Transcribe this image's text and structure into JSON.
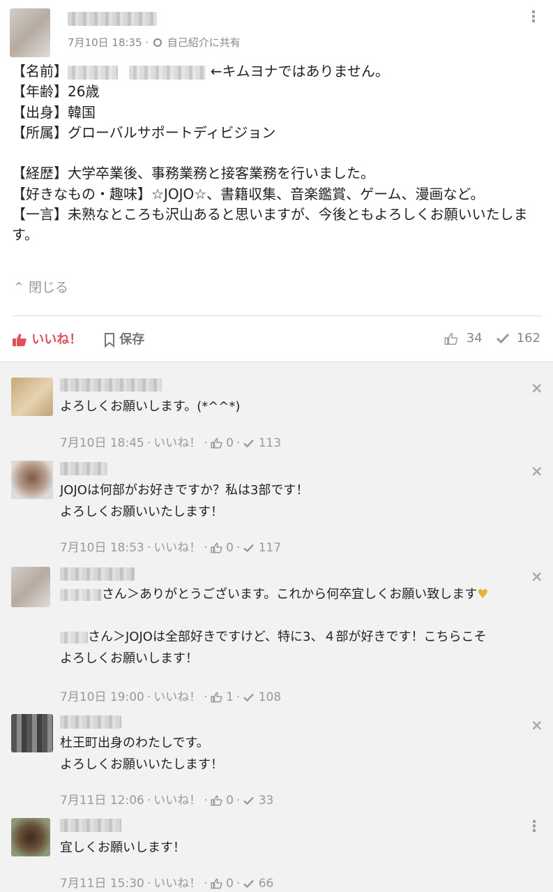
{
  "post": {
    "date": "7月10日 18:35",
    "share_target": "自己紹介に共有",
    "body": {
      "name_label": "【名前】",
      "name_suffix": "←キムヨナではありません。",
      "age": "【年齢】26歳",
      "origin": "【出身】韓国",
      "affiliation": "【所属】グローバルサポートディビジョン",
      "career": "【経歴】大学卒業後、事務業務と接客業務を行いました。",
      "hobbies": "【好きなもの・趣味】☆JOJO☆、書籍収集、音楽鑑賞、ゲーム、漫画など。",
      "comment": "【一言】未熟なところも沢山あると思いますが、今後ともよろしくお願いいたします。"
    },
    "collapse_label": "閉じる",
    "like_label": "いいね！",
    "save_label": "保存",
    "like_count": "34",
    "read_count": "162"
  },
  "comments": [
    {
      "text_lines": [
        "よろしくお願いします。(*^^*)"
      ],
      "date": "7月10日 18:45",
      "like_label": "いいね！",
      "likes": "0",
      "reads": "113"
    },
    {
      "text_lines": [
        "JOJOは何部がお好きですか？私は3部です！",
        "よろしくお願いいたします！"
      ],
      "date": "7月10日 18:53",
      "like_label": "いいね！",
      "likes": "0",
      "reads": "117"
    },
    {
      "reply1": "さん＞ありがとうございます。これから何卒宜しくお願い致します",
      "reply2_line1": "さん＞JOJOは全部好きですけど、特に3、４部が好きです！こちらこそ",
      "reply2_line2": "よろしくお願いします！",
      "date": "7月10日 19:00",
      "like_label": "いいね！",
      "likes": "1",
      "reads": "108"
    },
    {
      "text_lines": [
        "杜王町出身のわたしです。",
        "よろしくお願いいたします！"
      ],
      "date": "7月11日 12:06",
      "like_label": "いいね！",
      "likes": "0",
      "reads": "33"
    },
    {
      "text_lines": [
        "宜しくお願いします！"
      ],
      "date": "7月11日 15:30",
      "like_label": "いいね！",
      "likes": "0",
      "reads": "66"
    }
  ],
  "colors": {
    "like_red": "#e0505a",
    "meta_gray": "#999999",
    "heart_gold": "#e8b23a"
  },
  "icons": [
    "more-vert-icon",
    "circle-icon",
    "thumbs-up-icon",
    "bookmark-icon",
    "check-icon",
    "close-icon",
    "chevron-up-icon",
    "heart-icon"
  ]
}
